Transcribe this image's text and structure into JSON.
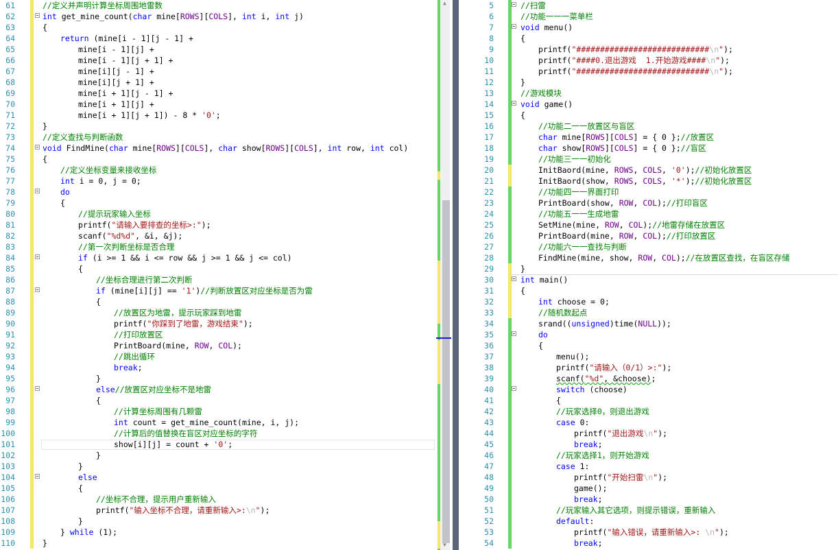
{
  "left_editor": {
    "lines": [
      {
        "n": 61,
        "indent": 0,
        "fold": false,
        "html": "<span class='cmt'>//定义并声明计算坐标周围地雷数</span>"
      },
      {
        "n": 62,
        "indent": 0,
        "fold": true,
        "html": "<span class='kw'>int</span> get_mine_count(<span class='kw'>char</span> mine[<span class='mac'>ROWS</span>][<span class='mac'>COLS</span>], <span class='kw'>int</span> i, <span class='kw'>int</span> j)"
      },
      {
        "n": 63,
        "indent": 0,
        "fold": false,
        "html": "{"
      },
      {
        "n": 64,
        "indent": 1,
        "fold": false,
        "html": "<span class='kw'>return</span> (mine[i - 1][j - 1] +"
      },
      {
        "n": 65,
        "indent": 2,
        "fold": false,
        "html": "mine[i - 1][j] +"
      },
      {
        "n": 66,
        "indent": 2,
        "fold": false,
        "html": "mine[i - 1][j + 1] +"
      },
      {
        "n": 67,
        "indent": 2,
        "fold": false,
        "html": "mine[i][j - 1] +"
      },
      {
        "n": 68,
        "indent": 2,
        "fold": false,
        "html": "mine[i][j + 1] +"
      },
      {
        "n": 69,
        "indent": 2,
        "fold": false,
        "html": "mine[i + 1][j - 1] +"
      },
      {
        "n": 70,
        "indent": 2,
        "fold": false,
        "html": "mine[i + 1][j] +"
      },
      {
        "n": 71,
        "indent": 2,
        "fold": false,
        "html": "mine[i + 1][j + 1]) - 8 * <span class='str'>'0'</span>;"
      },
      {
        "n": 72,
        "indent": 0,
        "fold": false,
        "html": "}"
      },
      {
        "n": 73,
        "indent": 0,
        "fold": false,
        "html": "<span class='cmt'>//定义查找与判断函数</span>"
      },
      {
        "n": 74,
        "indent": 0,
        "fold": true,
        "html": "<span class='kw'>void</span> FindMine(<span class='kw'>char</span> mine[<span class='mac'>ROWS</span>][<span class='mac'>COLS</span>], <span class='kw'>char</span> show[<span class='mac'>ROWS</span>][<span class='mac'>COLS</span>], <span class='kw'>int</span> row, <span class='kw'>int</span> col)"
      },
      {
        "n": 75,
        "indent": 0,
        "fold": false,
        "html": "{"
      },
      {
        "n": 76,
        "indent": 1,
        "fold": false,
        "html": "<span class='cmt'>//定义坐标变量来接收坐标</span>"
      },
      {
        "n": 77,
        "indent": 1,
        "fold": false,
        "html": "<span class='kw'>int</span> i = 0, j = 0;"
      },
      {
        "n": 78,
        "indent": 1,
        "fold": true,
        "html": "<span class='kw'>do</span>"
      },
      {
        "n": 79,
        "indent": 1,
        "fold": false,
        "html": "{"
      },
      {
        "n": 80,
        "indent": 2,
        "fold": false,
        "html": "<span class='cmt'>//提示玩家输入坐标</span>"
      },
      {
        "n": 81,
        "indent": 2,
        "fold": false,
        "html": "printf(<span class='str'>\"请输入要排查的坐标&gt;:\"</span>);"
      },
      {
        "n": 82,
        "indent": 2,
        "fold": false,
        "html": "scanf(<span class='str'>\"%d%d\"</span>, &amp;i, &amp;j);"
      },
      {
        "n": 83,
        "indent": 2,
        "fold": false,
        "html": "<span class='cmt'>//第一次判断坐标是否合理</span>"
      },
      {
        "n": 84,
        "indent": 2,
        "fold": true,
        "html": "<span class='kw'>if</span> (i &gt;= 1 &amp;&amp; i &lt;= row &amp;&amp; j &gt;= 1 &amp;&amp; j &lt;= col)"
      },
      {
        "n": 85,
        "indent": 2,
        "fold": false,
        "html": "{"
      },
      {
        "n": 86,
        "indent": 3,
        "fold": false,
        "html": "<span class='cmt'>//坐标合理进行第二次判断</span>"
      },
      {
        "n": 87,
        "indent": 3,
        "fold": true,
        "html": "<span class='kw'>if</span> (mine[i][j] == <span class='str'>'1'</span>)<span class='cmt'>//判断放置区对应坐标是否为雷</span>"
      },
      {
        "n": 88,
        "indent": 3,
        "fold": false,
        "html": "{"
      },
      {
        "n": 89,
        "indent": 4,
        "fold": false,
        "html": "<span class='cmt'>//放置区为地雷，提示玩家踩到地雷</span>"
      },
      {
        "n": 90,
        "indent": 4,
        "fold": false,
        "html": "printf(<span class='str'>\"你踩到了地雷，游戏结束\"</span>);"
      },
      {
        "n": 91,
        "indent": 4,
        "fold": false,
        "html": "<span class='cmt'>//打印放置区</span>"
      },
      {
        "n": 92,
        "indent": 4,
        "fold": false,
        "html": "PrintBoard(mine, <span class='mac'>ROW</span>, <span class='mac'>COL</span>);"
      },
      {
        "n": 93,
        "indent": 4,
        "fold": false,
        "html": "<span class='cmt'>//跳出循环</span>"
      },
      {
        "n": 94,
        "indent": 4,
        "fold": false,
        "html": "<span class='kw'>break</span>;"
      },
      {
        "n": 95,
        "indent": 3,
        "fold": false,
        "html": "}"
      },
      {
        "n": 96,
        "indent": 3,
        "fold": true,
        "html": "<span class='kw'>else</span><span class='cmt'>//放置区对应坐标不是地雷</span>"
      },
      {
        "n": 97,
        "indent": 3,
        "fold": false,
        "html": "{"
      },
      {
        "n": 98,
        "indent": 4,
        "fold": false,
        "html": "<span class='cmt'>//计算坐标周围有几颗雷</span>"
      },
      {
        "n": 99,
        "indent": 4,
        "fold": false,
        "html": "<span class='kw'>int</span> count = get_mine_count(mine, i, j);"
      },
      {
        "n": 100,
        "indent": 4,
        "fold": false,
        "html": "<span class='cmt'>//计算后的值替换在盲区对应坐标的字符</span>"
      },
      {
        "n": 101,
        "indent": 4,
        "fold": false,
        "html": "show[i][j] = count + <span class='str'>'0'</span>;"
      },
      {
        "n": 102,
        "indent": 3,
        "fold": false,
        "html": "}"
      },
      {
        "n": 103,
        "indent": 2,
        "fold": false,
        "html": "}"
      },
      {
        "n": 104,
        "indent": 2,
        "fold": true,
        "html": "<span class='kw'>else</span>"
      },
      {
        "n": 105,
        "indent": 2,
        "fold": false,
        "html": "{"
      },
      {
        "n": 106,
        "indent": 3,
        "fold": false,
        "html": "<span class='cmt'>//坐标不合理，提示用户重新输入</span>"
      },
      {
        "n": 107,
        "indent": 3,
        "fold": false,
        "html": "printf(<span class='str'>\"输入坐标不合理，请重新输入&gt;:<span class='esc'>\\n</span>\"</span>);"
      },
      {
        "n": 108,
        "indent": 2,
        "fold": false,
        "html": "}"
      },
      {
        "n": 109,
        "indent": 1,
        "fold": false,
        "html": "} <span class='kw'>while</span> (1);"
      },
      {
        "n": 110,
        "indent": 0,
        "fold": false,
        "html": "}"
      }
    ]
  },
  "right_editor": {
    "lines": [
      {
        "n": 5,
        "indent": 0,
        "fold": true,
        "html": "<span class='cmt'>//扫雷</span>"
      },
      {
        "n": 6,
        "indent": 0,
        "fold": false,
        "html": "<span class='cmt'>//功能一一一菜单栏</span>"
      },
      {
        "n": 7,
        "indent": 0,
        "fold": true,
        "html": "<span class='kw'>void</span> menu()"
      },
      {
        "n": 8,
        "indent": 0,
        "fold": false,
        "html": "{"
      },
      {
        "n": 9,
        "indent": 1,
        "fold": false,
        "html": "printf(<span class='str'>\"############################<span class='esc'>\\n</span>\"</span>);"
      },
      {
        "n": 10,
        "indent": 1,
        "fold": false,
        "html": "printf(<span class='str'>\"####0.退出游戏  1.开始游戏####<span class='esc'>\\n</span>\"</span>);"
      },
      {
        "n": 11,
        "indent": 1,
        "fold": false,
        "html": "printf(<span class='str'>\"############################<span class='esc'>\\n</span>\"</span>);"
      },
      {
        "n": 12,
        "indent": 0,
        "fold": false,
        "html": "}"
      },
      {
        "n": 13,
        "indent": 0,
        "fold": false,
        "html": "<span class='cmt'>//游戏模块</span>"
      },
      {
        "n": 14,
        "indent": 0,
        "fold": true,
        "html": "<span class='kw'>void</span> game()"
      },
      {
        "n": 15,
        "indent": 0,
        "fold": false,
        "html": "{"
      },
      {
        "n": 16,
        "indent": 1,
        "fold": false,
        "html": "<span class='cmt'>//功能二一一放置区与盲区</span>"
      },
      {
        "n": 17,
        "indent": 1,
        "fold": false,
        "html": "<span class='kw'>char</span> mine[<span class='mac'>ROWS</span>][<span class='mac'>COLS</span>] = { 0 };<span class='cmt'>//放置区</span>"
      },
      {
        "n": 18,
        "indent": 1,
        "fold": false,
        "html": "<span class='kw'>char</span> show[<span class='mac'>ROWS</span>][<span class='mac'>COLS</span>] = { 0 };<span class='cmt'>//盲区</span>"
      },
      {
        "n": 19,
        "indent": 1,
        "fold": false,
        "html": "<span class='cmt'>//功能三一一初始化</span>"
      },
      {
        "n": 20,
        "indent": 1,
        "fold": false,
        "html": "InitBaord(mine, <span class='mac'>ROWS</span>, <span class='mac'>COLS</span>, <span class='str'>'0'</span>);<span class='cmt'>//初始化放置区</span>"
      },
      {
        "n": 21,
        "indent": 1,
        "fold": false,
        "html": "InitBaord(show, <span class='mac'>ROWS</span>, <span class='mac'>COLS</span>, <span class='str'>'*'</span>);<span class='cmt'>//初始化放置区</span>"
      },
      {
        "n": 22,
        "indent": 1,
        "fold": false,
        "html": "<span class='cmt'>//功能四一一界面打印</span>"
      },
      {
        "n": 23,
        "indent": 1,
        "fold": false,
        "html": "PrintBoard(show, <span class='mac'>ROW</span>, <span class='mac'>COL</span>);<span class='cmt'>//打印盲区</span>"
      },
      {
        "n": 24,
        "indent": 1,
        "fold": false,
        "html": "<span class='cmt'>//功能五一一生成地雷</span>"
      },
      {
        "n": 25,
        "indent": 1,
        "fold": false,
        "html": "SetMine(mine, <span class='mac'>ROW</span>, <span class='mac'>COL</span>);<span class='cmt'>//地雷存储在放置区</span>"
      },
      {
        "n": 26,
        "indent": 1,
        "fold": false,
        "html": "PrintBoard(mine, <span class='mac'>ROW</span>, <span class='mac'>COL</span>);<span class='cmt'>//打印放置区</span>"
      },
      {
        "n": 27,
        "indent": 1,
        "fold": false,
        "html": "<span class='cmt'>//功能六一一查找与判断</span>"
      },
      {
        "n": 28,
        "indent": 1,
        "fold": false,
        "html": "FindMine(mine, show, <span class='mac'>ROW</span>, <span class='mac'>COL</span>);<span class='cmt'>//在放置区查找，在盲区存储</span>"
      },
      {
        "n": 29,
        "indent": 0,
        "fold": false,
        "html": "}"
      },
      {
        "n": 30,
        "indent": 0,
        "fold": true,
        "html": "<span class='kw'>int</span> main()"
      },
      {
        "n": 31,
        "indent": 0,
        "fold": false,
        "html": "{"
      },
      {
        "n": 32,
        "indent": 1,
        "fold": false,
        "html": "<span class='kw'>int</span> choose = 0;"
      },
      {
        "n": 33,
        "indent": 1,
        "fold": false,
        "html": "<span class='cmt'>//随机数起点</span>"
      },
      {
        "n": 34,
        "indent": 1,
        "fold": false,
        "html": "srand((<span class='kw'>unsigned</span>)time(<span class='mac'>NULL</span>));"
      },
      {
        "n": 35,
        "indent": 1,
        "fold": true,
        "html": "<span class='kw'>do</span>"
      },
      {
        "n": 36,
        "indent": 1,
        "fold": false,
        "html": "{"
      },
      {
        "n": 37,
        "indent": 2,
        "fold": false,
        "html": "menu();"
      },
      {
        "n": 38,
        "indent": 2,
        "fold": false,
        "html": "printf(<span class='str'>\"请输入（0/1）&gt;:\"</span>);"
      },
      {
        "n": 39,
        "indent": 2,
        "fold": false,
        "html": "<span class='squig'>scanf(<span class='str'>\"%d\"</span>, &amp;choose)</span>;"
      },
      {
        "n": 40,
        "indent": 2,
        "fold": true,
        "html": "<span class='kw'>switch</span> (choose)"
      },
      {
        "n": 41,
        "indent": 2,
        "fold": false,
        "html": "{"
      },
      {
        "n": 42,
        "indent": 2,
        "fold": false,
        "html": "<span class='cmt'>//玩家选择0，则退出游戏</span>"
      },
      {
        "n": 43,
        "indent": 2,
        "fold": false,
        "html": "<span class='kw'>case</span> 0:"
      },
      {
        "n": 44,
        "indent": 3,
        "fold": false,
        "html": "printf(<span class='str'>\"退出游戏<span class='esc'>\\n</span>\"</span>);"
      },
      {
        "n": 45,
        "indent": 3,
        "fold": false,
        "html": "<span class='kw'>break</span>;"
      },
      {
        "n": 46,
        "indent": 2,
        "fold": false,
        "html": "<span class='cmt'>//玩家选择1，则开始游戏</span>"
      },
      {
        "n": 47,
        "indent": 2,
        "fold": false,
        "html": "<span class='kw'>case</span> 1:"
      },
      {
        "n": 48,
        "indent": 3,
        "fold": false,
        "html": "printf(<span class='str'>\"开始扫雷<span class='esc'>\\n</span>\"</span>);"
      },
      {
        "n": 49,
        "indent": 3,
        "fold": false,
        "html": "game();"
      },
      {
        "n": 50,
        "indent": 3,
        "fold": false,
        "html": "<span class='kw'>break</span>;"
      },
      {
        "n": 51,
        "indent": 2,
        "fold": false,
        "html": "<span class='cmt'>//玩家输入其它选项，则提示错误，重新输入</span>"
      },
      {
        "n": 52,
        "indent": 2,
        "fold": false,
        "html": "<span class='kw'>default</span>:"
      },
      {
        "n": 53,
        "indent": 3,
        "fold": false,
        "html": "printf(<span class='str'>\"输入错误，请重新输入&gt;: <span class='esc'>\\n</span>\"</span>);"
      },
      {
        "n": 54,
        "indent": 3,
        "fold": false,
        "html": "<span class='kw'>break</span>;"
      }
    ]
  },
  "colors": {
    "line_number": "#2b91af",
    "keyword": "#0000ff",
    "string": "#a31515",
    "comment": "#008000",
    "macro": "#6f008a",
    "change_saved": "#6bd36b",
    "change_unsaved": "#f5e76a"
  }
}
